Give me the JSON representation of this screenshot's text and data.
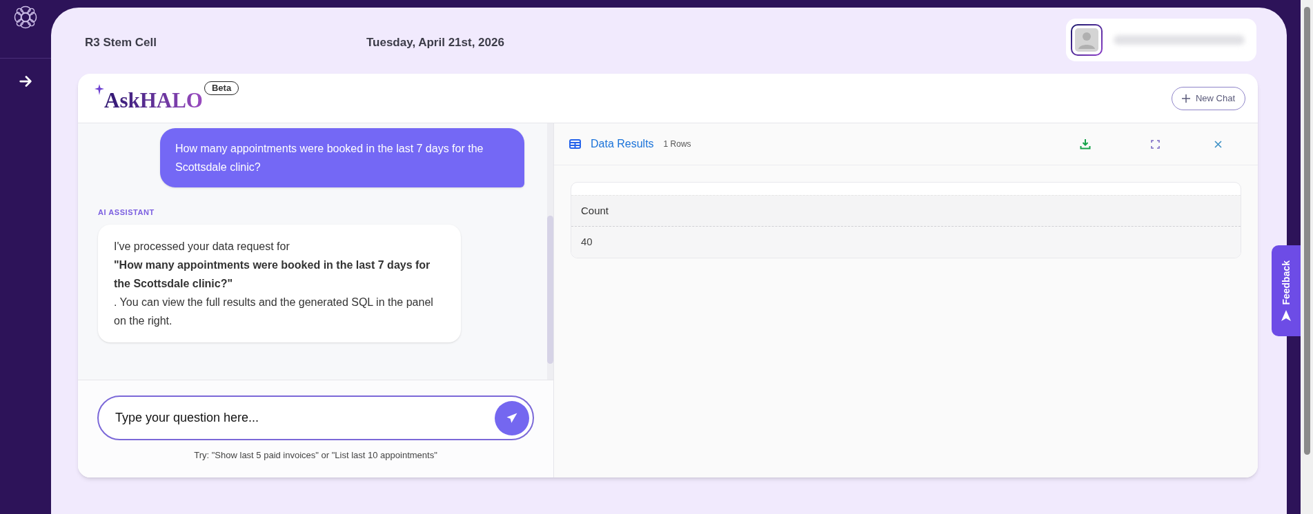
{
  "header": {
    "org_name": "R3 Stem Cell",
    "date": "Tuesday, April 21st, 2026"
  },
  "chat": {
    "brand": "AskHALO",
    "badge": "Beta",
    "new_chat": "New Chat",
    "messages": [
      {
        "kind": "user",
        "text": "How many appointments were booked in the last 7 days for the Scottsdale clinic?"
      },
      {
        "kind": "assistant",
        "sender": "AI ASSISTANT",
        "text": "I've processed your data request for **\"How many appointments were booked in the last 7 days for the Scottsdale clinic?\"** . You can view the full results and the generated SQL in the panel on the right."
      }
    ],
    "input": {
      "placeholder": "Type your question here..."
    },
    "hint": "Try: \"Show last 5 paid invoices\" or \"List last 10 appointments\""
  },
  "results": {
    "title": "Data Results",
    "row_count": "1 Rows",
    "columns": [
      "Count"
    ],
    "rows": [
      [
        "40"
      ]
    ]
  },
  "feedback": "Feedback"
}
